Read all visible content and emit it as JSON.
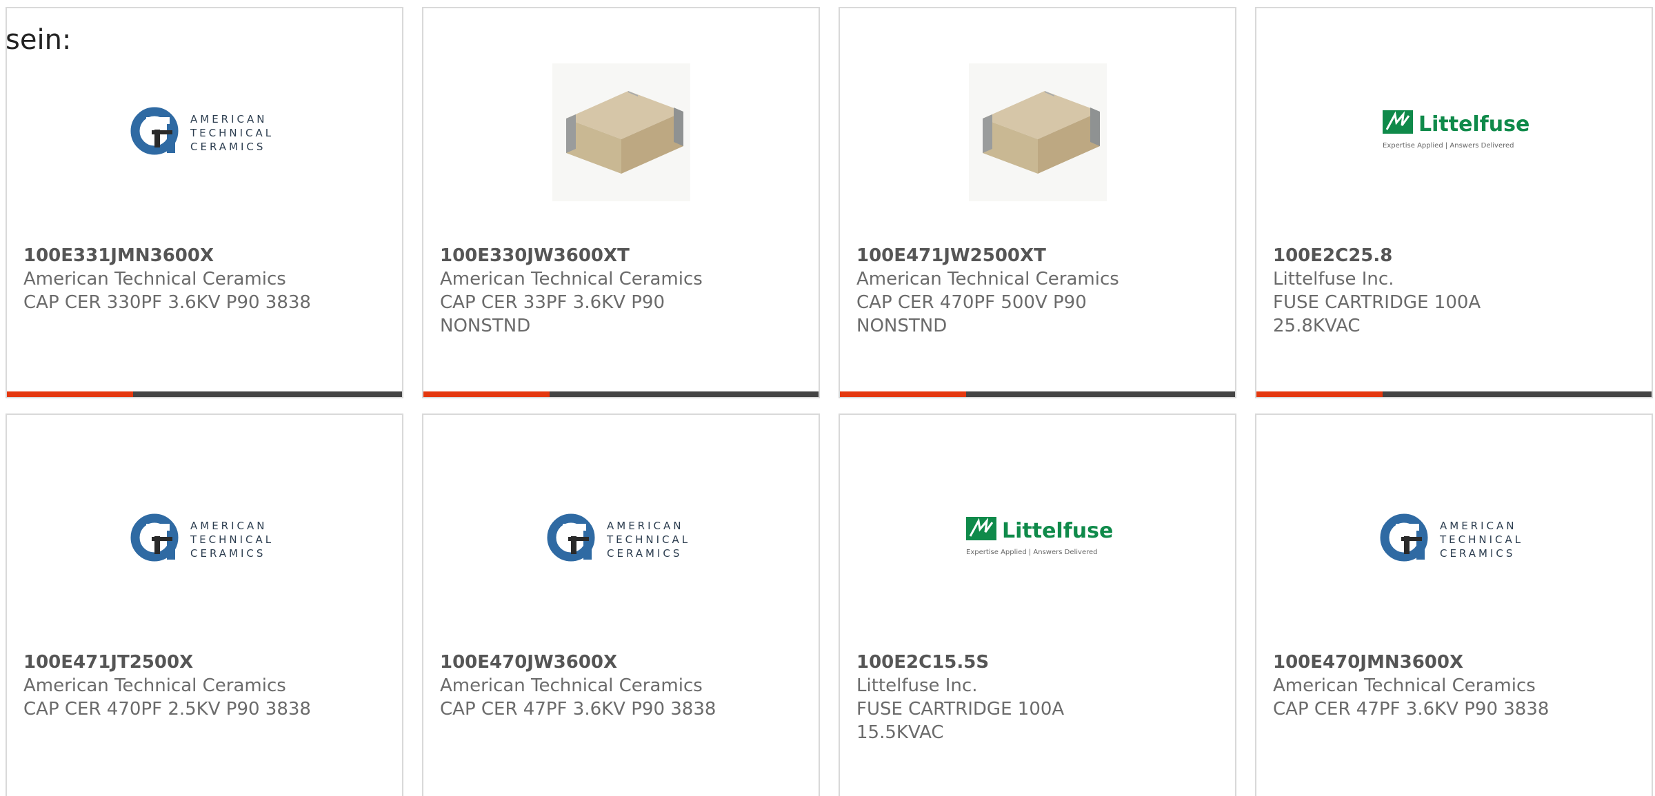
{
  "intro_text": "sein:",
  "logo_text": {
    "atc_lines": [
      "AMERICAN",
      "TECHNICAL",
      "CERAMICS"
    ],
    "littelfuse_name": "Littelfuse",
    "littelfuse_tagline": "Expertise Applied | Answers Delivered"
  },
  "colors": {
    "accent": "#e4380f",
    "bar": "#444444",
    "littelfuse_green": "#0f8a4a",
    "atc_blue": "#2f6aa3"
  },
  "products": [
    {
      "part_number": "100E331JMN3600X",
      "manufacturer": "American Technical Ceramics",
      "description": "CAP CER 330PF 3.6KV P90 3838",
      "image": "atc-logo"
    },
    {
      "part_number": "100E330JW3600XT",
      "manufacturer": "American Technical Ceramics",
      "description": "CAP CER 33PF 3.6KV P90 NONSTND",
      "image": "capacitor-chip"
    },
    {
      "part_number": "100E471JW2500XT",
      "manufacturer": "American Technical Ceramics",
      "description": "CAP CER 470PF 500V P90 NONSTND",
      "image": "capacitor-chip"
    },
    {
      "part_number": "100E2C25.8",
      "manufacturer": "Littelfuse Inc.",
      "description": "FUSE CARTRIDGE 100A 25.8KVAC",
      "image": "littelfuse-logo"
    },
    {
      "part_number": "100E471JT2500X",
      "manufacturer": "American Technical Ceramics",
      "description": "CAP CER 470PF 2.5KV P90 3838",
      "image": "atc-logo"
    },
    {
      "part_number": "100E470JW3600X",
      "manufacturer": "American Technical Ceramics",
      "description": "CAP CER 47PF 3.6KV P90 3838",
      "image": "atc-logo"
    },
    {
      "part_number": "100E2C15.5S",
      "manufacturer": "Littelfuse Inc.",
      "description": "FUSE CARTRIDGE 100A 15.5KVAC",
      "image": "littelfuse-logo"
    },
    {
      "part_number": "100E470JMN3600X",
      "manufacturer": "American Technical Ceramics",
      "description": "CAP CER 47PF 3.6KV P90 3838",
      "image": "atc-logo"
    }
  ]
}
